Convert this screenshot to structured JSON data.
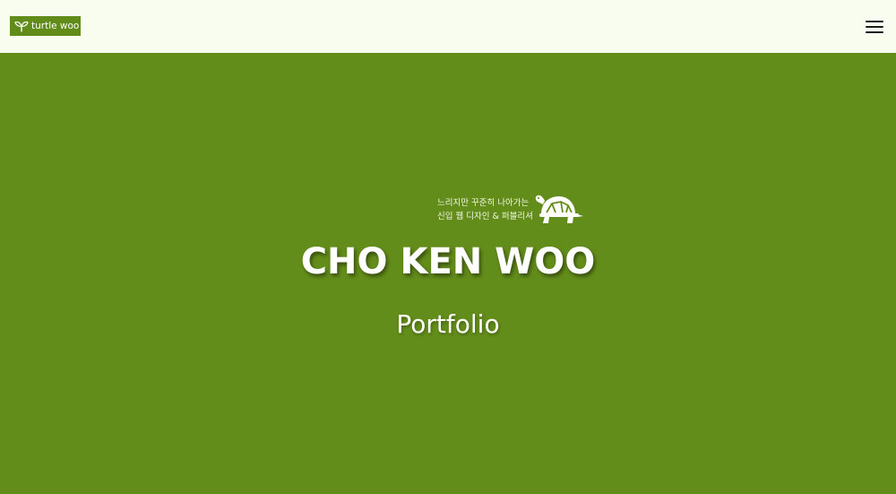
{
  "header": {
    "logo_text": "turtle woo",
    "logo_icon": "sprout-icon",
    "menu_icon": "hamburger-menu-icon"
  },
  "hero": {
    "tagline_line1": "느리지만 꾸준히 나아가는",
    "tagline_line2": "신입 웹 디자인 & 퍼블리셔",
    "tagline_icon": "turtle-icon",
    "title": "CHO KEN WOO",
    "subtitle": "Portfolio"
  },
  "colors": {
    "header_bg": "#f8fdf0",
    "hero_bg": "#638d1a",
    "logo_bg": "#628c1a",
    "text_light": "#ffffff"
  }
}
